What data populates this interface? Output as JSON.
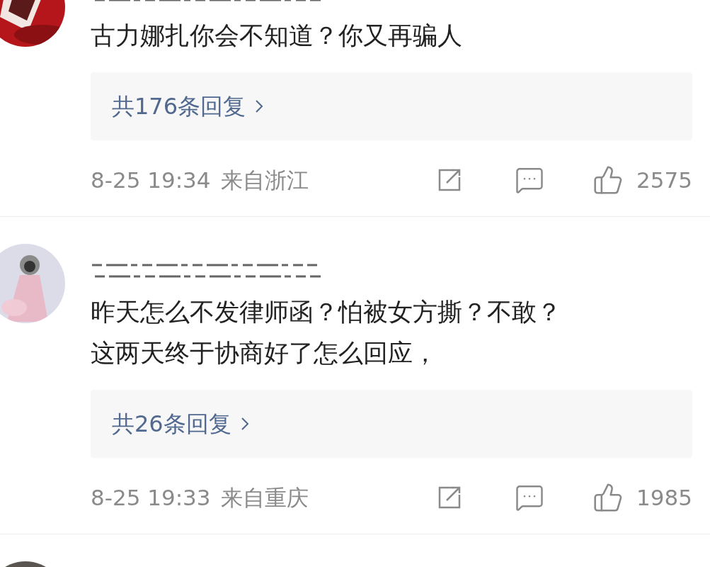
{
  "comments": [
    {
      "avatar": {
        "kind": "picture"
      },
      "text_lines": [
        "古力娜扎你会不知道？你又再骗人"
      ],
      "replies": {
        "label": "共176条回复"
      },
      "time": "8-25 19:34",
      "location": "来自浙江",
      "likes": "2575"
    },
    {
      "avatar": {
        "kind": "picture"
      },
      "text_lines": [
        "昨天怎么不发律师函？怕被女方撕？不敢？",
        "这两天终于协商好了怎么回应，"
      ],
      "replies": {
        "label": "共26条回复"
      },
      "time": "8-25 19:33",
      "location": "来自重庆",
      "likes": "1985"
    },
    {
      "avatar": {
        "kind": "picture"
      }
    }
  ]
}
